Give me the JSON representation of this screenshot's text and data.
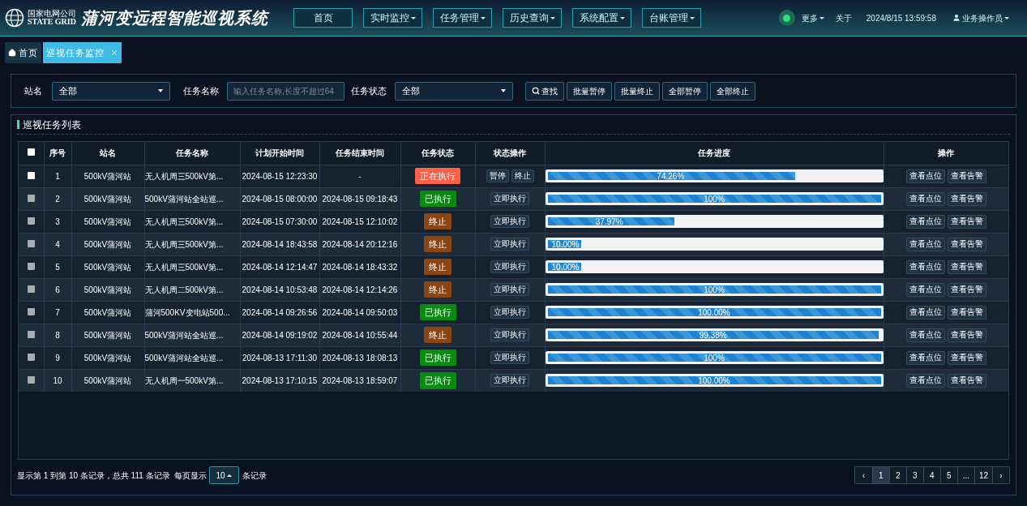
{
  "header": {
    "org_name": "国家电网公司",
    "org_name_en": "STATE GRID",
    "title": "蒲河变远程智能巡视系统",
    "nav": [
      {
        "label": "首页",
        "dropdown": false
      },
      {
        "label": "实时监控",
        "dropdown": true
      },
      {
        "label": "任务管理",
        "dropdown": true
      },
      {
        "label": "历史查询",
        "dropdown": true
      },
      {
        "label": "系统配置",
        "dropdown": true
      },
      {
        "label": "台账管理",
        "dropdown": true
      }
    ],
    "status_on": true,
    "more": "更多",
    "about": "关于",
    "datetime": "2024/8/15 13:59:58",
    "user": "业务操作员"
  },
  "tabs": [
    {
      "label": "首页",
      "selected": false,
      "closable": false
    },
    {
      "label": "巡视任务监控",
      "selected": true,
      "closable": true
    }
  ],
  "filters": {
    "station_label": "站名",
    "station_value": "全部",
    "name_label": "任务名称",
    "name_placeholder": "输入任务名称,长度不超过64",
    "status_label": "任务状态",
    "status_value": "全部",
    "buttons": [
      {
        "label": "查找",
        "search": true
      },
      {
        "label": "批量暂停",
        "search": false
      },
      {
        "label": "批量终止",
        "search": false
      },
      {
        "label": "全部暂停",
        "search": false
      },
      {
        "label": "全部终止",
        "search": false
      }
    ]
  },
  "list": {
    "title": "巡视任务列表",
    "select_all_checked": false,
    "columns": [
      "序号",
      "站名",
      "任务名称",
      "计划开始时间",
      "任务结束时间",
      "任务状态",
      "状态操作",
      "任务进度",
      "操作"
    ],
    "rows": [
      {
        "checked": false,
        "disabled": false,
        "no": "1",
        "station": "500kV蒲河站",
        "name": "无人机周三500kV第...",
        "start": "2024-08-15 12:23:30",
        "end": "-",
        "status": "正在执行",
        "kind": "running",
        "actions": [
          "暂停",
          "终止"
        ],
        "level": 0.7426,
        "progress": "74.26%",
        "ops": [
          "查看点位",
          "查看告警"
        ]
      },
      {
        "checked": false,
        "disabled": true,
        "no": "2",
        "station": "500kV蒲河站",
        "name": "500kV蒲河站全站巡...",
        "start": "2024-08-15 08:00:00",
        "end": "2024-08-15 09:18:43",
        "status": "已执行",
        "kind": "done",
        "actions": [
          "立即执行"
        ],
        "level": 1,
        "progress": "100%",
        "ops": [
          "查看点位",
          "查看告警"
        ]
      },
      {
        "checked": false,
        "disabled": true,
        "no": "3",
        "station": "500kV蒲河站",
        "name": "无人机周三500kV第...",
        "start": "2024-08-15 07:30:00",
        "end": "2024-08-15 12:10:02",
        "status": "终止",
        "kind": "stopped",
        "actions": [
          "立即执行"
        ],
        "level": 0.3797,
        "progress": "37.97%",
        "ops": [
          "查看点位",
          "查看告警"
        ]
      },
      {
        "checked": false,
        "disabled": true,
        "no": "4",
        "station": "500kV蒲河站",
        "name": "无人机周三500kV第...",
        "start": "2024-08-14 18:43:58",
        "end": "2024-08-14 20:12:16",
        "status": "终止",
        "kind": "stopped",
        "actions": [
          "立即执行"
        ],
        "level": 0.1,
        "progress": "10.00%",
        "ops": [
          "查看点位",
          "查看告警"
        ]
      },
      {
        "checked": false,
        "disabled": true,
        "no": "5",
        "station": "500kV蒲河站",
        "name": "无人机周三500kV第...",
        "start": "2024-08-14 12:14:47",
        "end": "2024-08-14 18:43:32",
        "status": "终止",
        "kind": "stopped",
        "actions": [
          "立即执行"
        ],
        "level": 0.1,
        "progress": "10.00%",
        "ops": [
          "查看点位",
          "查看告警"
        ]
      },
      {
        "checked": false,
        "disabled": true,
        "no": "6",
        "station": "500kV蒲河站",
        "name": "无人机周二500kV第...",
        "start": "2024-08-14 10:53:48",
        "end": "2024-08-14 12:14:26",
        "status": "终止",
        "kind": "stopped",
        "actions": [
          "立即执行"
        ],
        "level": 1,
        "progress": "100%",
        "ops": [
          "查看点位",
          "查看告警"
        ]
      },
      {
        "checked": false,
        "disabled": true,
        "no": "7",
        "station": "500kV蒲河站",
        "name": "蒲河500KV变电站500...",
        "start": "2024-08-14 09:26:56",
        "end": "2024-08-14 09:50:03",
        "status": "已执行",
        "kind": "done",
        "actions": [
          "立即执行"
        ],
        "level": 1,
        "progress": "100.00%",
        "ops": [
          "查看点位",
          "查看告警"
        ]
      },
      {
        "checked": false,
        "disabled": true,
        "no": "8",
        "station": "500kV蒲河站",
        "name": "500kV蒲河站全站巡...",
        "start": "2024-08-14 09:19:02",
        "end": "2024-08-14 10:55:44",
        "status": "终止",
        "kind": "stopped",
        "actions": [
          "立即执行"
        ],
        "level": 0.9938,
        "progress": "99.38%",
        "ops": [
          "查看点位",
          "查看告警"
        ]
      },
      {
        "checked": false,
        "disabled": true,
        "no": "9",
        "station": "500kV蒲河站",
        "name": "500kV蒲河站全站巡...",
        "start": "2024-08-13 17:11:30",
        "end": "2024-08-13 18:08:13",
        "status": "已执行",
        "kind": "done",
        "actions": [
          "立即执行"
        ],
        "level": 1,
        "progress": "100%",
        "ops": [
          "查看点位",
          "查看告警"
        ]
      },
      {
        "checked": false,
        "disabled": true,
        "no": "10",
        "station": "500kV蒲河站",
        "name": "无人机周一500kV第...",
        "start": "2024-08-13 17:10:15",
        "end": "2024-08-13 18:59:07",
        "status": "已执行",
        "kind": "done",
        "actions": [
          "立即执行"
        ],
        "level": 1,
        "progress": "100.00%",
        "ops": [
          "查看点位",
          "查看告警"
        ]
      }
    ]
  },
  "footer": {
    "summary": "显示第 1 到第 10 条记录，总共 111 条记录",
    "per_page_label": "每页显示",
    "per_page": "10",
    "per_page_unit": "条记录",
    "pages": [
      {
        "label": "‹",
        "selected": false
      },
      {
        "label": "1",
        "selected": true
      },
      {
        "label": "2",
        "selected": false
      },
      {
        "label": "3",
        "selected": false
      },
      {
        "label": "4",
        "selected": false
      },
      {
        "label": "5",
        "selected": false
      },
      {
        "label": "...",
        "selected": false
      },
      {
        "label": "12",
        "selected": false
      },
      {
        "label": "›",
        "selected": false
      }
    ]
  }
}
